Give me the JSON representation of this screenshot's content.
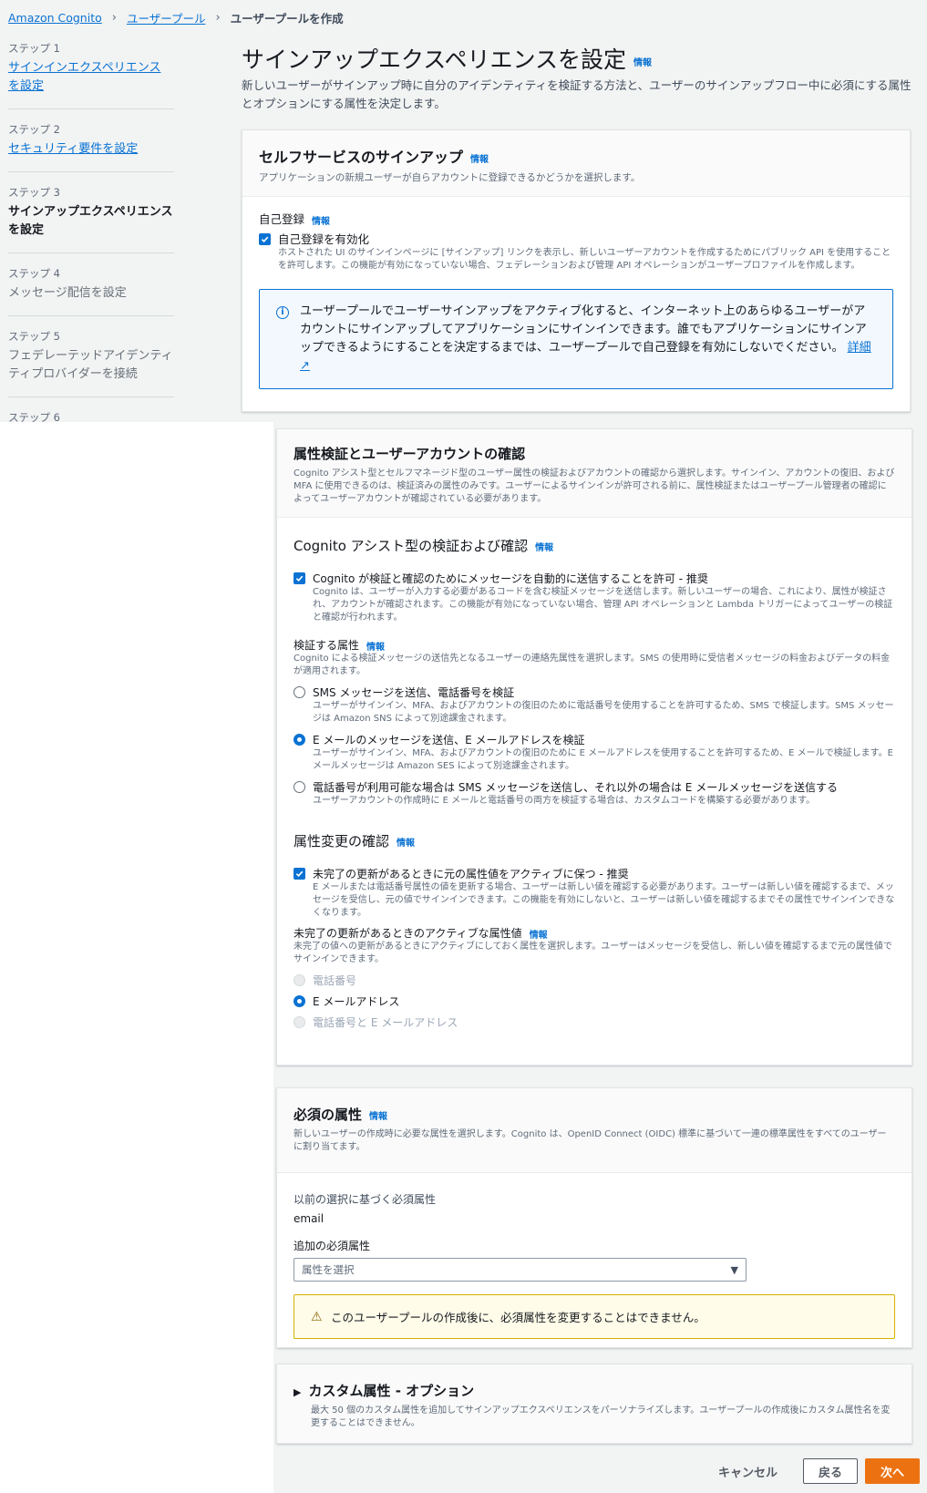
{
  "breadcrumb": {
    "root": "Amazon Cognito",
    "parent": "ユーザープール",
    "current": "ユーザープールを作成"
  },
  "steps": [
    {
      "num": "ステップ 1",
      "title": "サインインエクスペリエンスを設定"
    },
    {
      "num": "ステップ 2",
      "title": "セキュリティ要件を設定"
    },
    {
      "num": "ステップ 3",
      "title": "サインアップエクスペリエンスを設定"
    },
    {
      "num": "ステップ 4",
      "title": "メッセージ配信を設定"
    },
    {
      "num": "ステップ 5",
      "title": "フェデレーテッドアイデンティティプロバイダーを接続"
    },
    {
      "num": "ステップ 6"
    }
  ],
  "info_label": "情報",
  "page": {
    "title": "サインアップエクスペリエンスを設定",
    "desc": "新しいユーザーがサインアップ時に自分のアイデンティティを検証する方法と、ユーザーのサインアップフロー中に必須にする属性とオプションにする属性を決定します。"
  },
  "self_service": {
    "title": "セルフサービスのサインアップ",
    "desc": "アプリケーションの新規ユーザーが自らアカウントに登録できるかどうかを選択します。",
    "field_label": "自己登録",
    "checkbox_label": "自己登録を有効化",
    "checkbox_desc": "ホストされた UI のサインインページに [サインアップ] リンクを表示し、新しいユーザーアカウントを作成するためにパブリック API を使用することを許可します。この機能が有効になっていない場合、フェデレーションおよび管理 API オペレーションがユーザープロファイルを作成します。",
    "alert": "ユーザープールでユーザーサインアップをアクティブ化すると、インターネット上のあらゆるユーザーがアカウントにサインアップしてアプリケーションにサインインできます。誰でもアプリケーションにサインアップできるようにすることを決定するまでは、ユーザープールで自己登録を有効にしないでください。",
    "alert_link": "詳細"
  },
  "verification": {
    "title": "属性検証とユーザーアカウントの確認",
    "desc": "Cognito アシスト型とセルフマネージド型のユーザー属性の検証およびアカウントの確認から選択します。サインイン、アカウントの復旧、および MFA に使用できるのは、検証済みの属性のみです。ユーザーによるサインインが許可される前に、属性検証またはユーザープール管理者の確認によってユーザーアカウントが確認されている必要があります。",
    "assist_title": "Cognito アシスト型の検証および確認",
    "allow_label": "Cognito が検証と確認のためにメッセージを自動的に送信することを許可 - 推奨",
    "allow_desc": "Cognito は、ユーザーが入力する必要があるコードを含む検証メッセージを送信します。新しいユーザーの場合、これにより、属性が検証され、アカウントが確認されます。この機能が有効になっていない場合、管理 API オペレーションと Lambda トリガーによってユーザーの検証と確認が行われます。",
    "attr_label": "検証する属性",
    "attr_desc": "Cognito による検証メッセージの送信先となるユーザーの連絡先属性を選択します。SMS の使用時に受信者メッセージの料金およびデータの料金が適用されます。",
    "options": [
      {
        "label": "SMS メッセージを送信、電話番号を検証",
        "desc": "ユーザーがサインイン、MFA、およびアカウントの復旧のために電話番号を使用することを許可するため、SMS で検証します。SMS メッセージは Amazon SNS によって別途課金されます。"
      },
      {
        "label": "E メールのメッセージを送信、E メールアドレスを検証",
        "desc": "ユーザーがサインイン、MFA、およびアカウントの復旧のために E メールアドレスを使用することを許可するため、E メールで検証します。E メールメッセージは Amazon SES によって別途課金されます。"
      },
      {
        "label": "電話番号が利用可能な場合は SMS メッセージを送信し、それ以外の場合は E メールメッセージを送信する",
        "desc": "ユーザーアカウントの作成時に E メールと電話番号の両方を検証する場合は、カスタムコードを構築する必要があります。"
      }
    ],
    "change_title": "属性変更の確認",
    "keep_label": "未完了の更新があるときに元の属性値をアクティブに保つ - 推奨",
    "keep_desc": "E メールまたは電話番号属性の値を更新する場合、ユーザーは新しい値を確認する必要があります。ユーザーは新しい値を確認するまで、メッセージを受信し、元の値でサインインできます。この機能を有効にしないと、ユーザーは新しい値を確認するまでその属性でサインインできなくなります。",
    "active_label": "未完了の更新があるときのアクティブな属性値",
    "active_desc": "未完了の値への更新があるときにアクティブにしておく属性を選択します。ユーザーはメッセージを受信し、新しい値を確認するまで元の属性値でサインインできます。",
    "active_options": [
      "電話番号",
      "E メールアドレス",
      "電話番号と E メールアドレス"
    ]
  },
  "required": {
    "title": "必須の属性",
    "desc": "新しいユーザーの作成時に必要な属性を選択します。Cognito は、OpenID Connect (OIDC) 標準に基づいて一連の標準属性をすべてのユーザーに割り当てます。",
    "prev_label": "以前の選択に基づく必須属性",
    "prev_value": "email",
    "add_label": "追加の必須属性",
    "select_placeholder": "属性を選択",
    "warning": "このユーザープールの作成後に、必須属性を変更することはできません。"
  },
  "custom": {
    "title": "カスタム属性 - オプション",
    "desc": "最大 50 個のカスタム属性を追加してサインアップエクスペリエンスをパーソナライズします。ユーザープールの作成後にカスタム属性名を変更することはできません。"
  },
  "buttons": {
    "cancel": "キャンセル",
    "back": "戻る",
    "next": "次へ"
  }
}
